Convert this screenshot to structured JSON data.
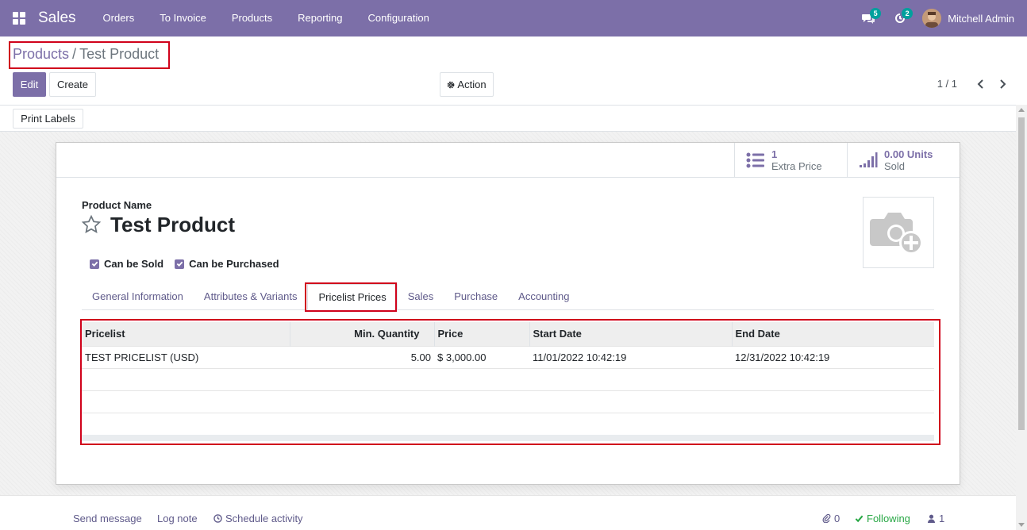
{
  "navbar": {
    "app_name": "Sales",
    "menu": [
      "Orders",
      "To Invoice",
      "Products",
      "Reporting",
      "Configuration"
    ],
    "messages_count": "5",
    "activities_count": "2",
    "user_name": "Mitchell Admin"
  },
  "breadcrumb": {
    "parent": "Products",
    "separator": "/",
    "current": "Test Product"
  },
  "toolbar": {
    "edit_label": "Edit",
    "create_label": "Create",
    "action_label": "Action",
    "pager": "1 / 1",
    "print_labels": "Print Labels"
  },
  "stat_buttons": [
    {
      "value": "1",
      "label": "Extra Price",
      "icon": "list-icon"
    },
    {
      "value": "0.00 Units",
      "label": "Sold",
      "icon": "bar-signal-icon"
    }
  ],
  "form": {
    "product_name_label": "Product Name",
    "product_name": "Test Product",
    "can_be_sold_label": "Can be Sold",
    "can_be_sold": true,
    "can_be_purchased_label": "Can be Purchased",
    "can_be_purchased": true
  },
  "tabs": [
    {
      "label": "General Information",
      "active": false
    },
    {
      "label": "Attributes & Variants",
      "active": false
    },
    {
      "label": "Pricelist Prices",
      "active": true
    },
    {
      "label": "Sales",
      "active": false
    },
    {
      "label": "Purchase",
      "active": false
    },
    {
      "label": "Accounting",
      "active": false
    }
  ],
  "pricelist_table": {
    "columns": [
      "Pricelist",
      "Min. Quantity",
      "Price",
      "Start Date",
      "End Date"
    ],
    "rows": [
      {
        "pricelist": "TEST PRICELIST (USD)",
        "min_qty": "5.00",
        "price": "$ 3,000.00",
        "start": "11/01/2022 10:42:19",
        "end": "12/31/2022 10:42:19"
      }
    ]
  },
  "chatter": {
    "send_message": "Send message",
    "log_note": "Log note",
    "schedule_activity": "Schedule activity",
    "attachments": "0",
    "following": "Following",
    "followers": "1"
  },
  "colors": {
    "brand": "#7c6fa8",
    "highlight": "#d0021b",
    "badge": "#00a09d",
    "following": "#28a745"
  }
}
